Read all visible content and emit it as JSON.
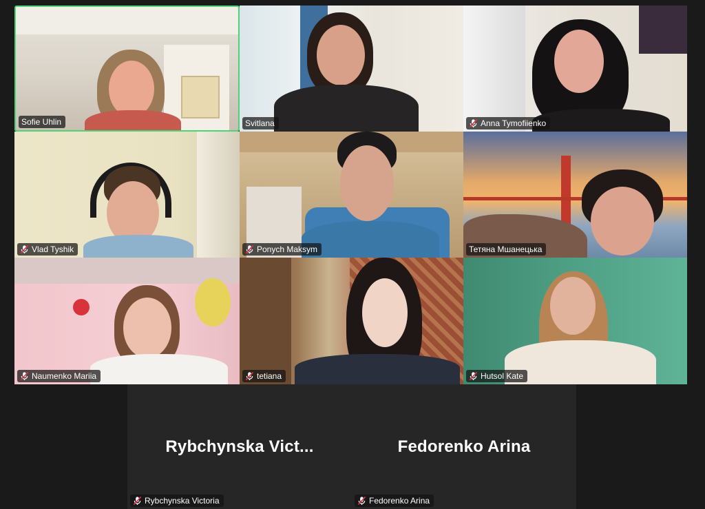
{
  "participants": [
    {
      "name": "Sofie Uhlin",
      "muted": false,
      "active": true
    },
    {
      "name": "Svitlana",
      "muted": false,
      "active": false
    },
    {
      "name": "Anna Tymofiienko",
      "muted": true,
      "active": false
    },
    {
      "name": "Vlad Tyshik",
      "muted": true,
      "active": false
    },
    {
      "name": "Ponych Maksym",
      "muted": true,
      "active": false
    },
    {
      "name": "Тетяна Мшанецька",
      "muted": false,
      "active": false
    },
    {
      "name": "Naumenko Mariia",
      "muted": true,
      "active": false
    },
    {
      "name": "tetiana",
      "muted": true,
      "active": false
    },
    {
      "name": "Hutsol Kate",
      "muted": true,
      "active": false
    }
  ],
  "camera_off": [
    {
      "display_name": "Rybchynska  Vict...",
      "tag_name": "Rybchynska Victoria",
      "muted": true
    },
    {
      "display_name": "Fedorenko Arina",
      "tag_name": "Fedorenko Arina",
      "muted": true
    }
  ],
  "icons": {
    "muted": "mic-muted-icon"
  },
  "colors": {
    "active_speaker_border": "#4fd17a",
    "muted_icon": "#e0314b",
    "background": "#1a1a1a"
  }
}
